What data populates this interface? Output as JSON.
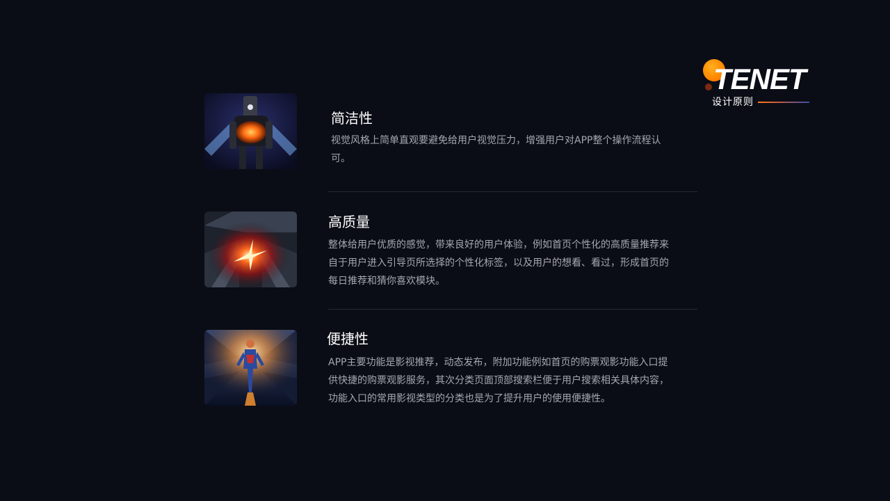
{
  "logo": {
    "name": "TENET",
    "subtitle": "设计原则"
  },
  "principles": [
    {
      "title": "简洁性",
      "description": "视觉风格上简单直观要避免给用户视觉压力，增强用户对APP整个操作流程认可。",
      "image": "robot-poster-image"
    },
    {
      "title": "高质量",
      "description": "整体给用户优质的感觉，带来良好的用户体验，例如首页个性化的高质量推荐来自于用户进入引导页所选择的个性化标签，以及用户的想看、看过，形成首页的每日推荐和猜你喜欢模块。",
      "image": "justice-league-poster-image"
    },
    {
      "title": "便捷性",
      "description": "APP主要功能是影视推荐，动态发布，附加功能例如首页的购票观影功能入口提供快捷的购票观影服务，其次分类页面顶部搜索栏便于用户搜索相关具体内容，功能入口的常用影视类型的分类也是为了提升用户的使用便捷性。",
      "image": "captain-marvel-poster-image"
    }
  ],
  "colors": {
    "background": "#0b0d16",
    "accent_orange": "#ff8a00",
    "accent_blue": "#3a4bb0",
    "text_primary": "#ffffff",
    "text_secondary": "#a4a7b3"
  }
}
